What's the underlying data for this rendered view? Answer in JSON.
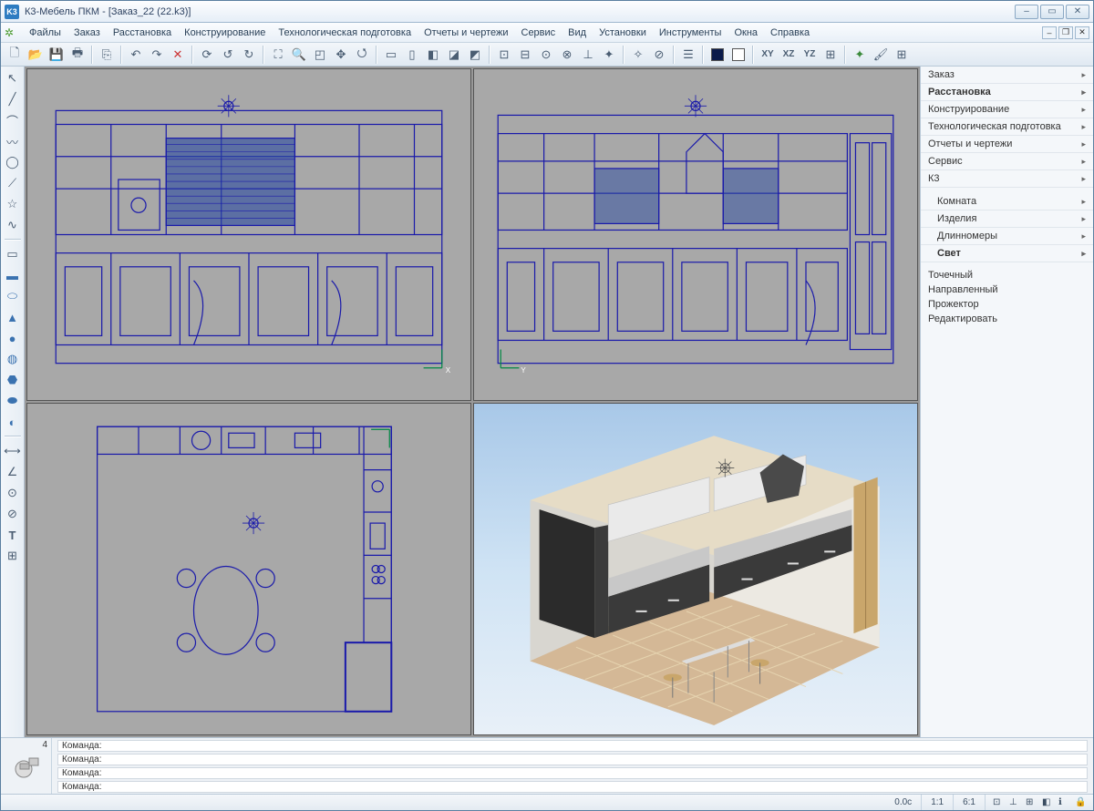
{
  "title": "К3-Мебель ПКМ - [Заказ_22 (22.k3)]",
  "app_icon": "K3",
  "menu": [
    "Файлы",
    "Заказ",
    "Расстановка",
    "Конструирование",
    "Технологическая подготовка",
    "Отчеты и чертежи",
    "Сервис",
    "Вид",
    "Установки",
    "Инструменты",
    "Окна",
    "Справка"
  ],
  "axis_labels": {
    "xy": "XY",
    "xz": "XZ",
    "yz": "YZ"
  },
  "right_panel": {
    "group1": [
      {
        "label": "Заказ",
        "bold": false
      },
      {
        "label": "Расстановка",
        "bold": true
      },
      {
        "label": "Конструирование",
        "bold": false
      },
      {
        "label": "Технологическая подготовка",
        "bold": false
      },
      {
        "label": "Отчеты и чертежи",
        "bold": false
      },
      {
        "label": "Сервис",
        "bold": false
      },
      {
        "label": "К3",
        "bold": false
      }
    ],
    "group2": [
      {
        "label": "Комната",
        "bold": false
      },
      {
        "label": "Изделия",
        "bold": false
      },
      {
        "label": "Длинномеры",
        "bold": false
      },
      {
        "label": "Свет",
        "bold": true
      }
    ],
    "group3": [
      "Точечный",
      "Направленный",
      "Прожектор",
      "Редактировать"
    ]
  },
  "cmd_count": "4",
  "cmd_lines": [
    "Команда:",
    "Команда:",
    "Команда:",
    "Команда:"
  ],
  "status": {
    "time": "0.0c",
    "ratio1": "1:1",
    "ratio2": "6:1"
  }
}
